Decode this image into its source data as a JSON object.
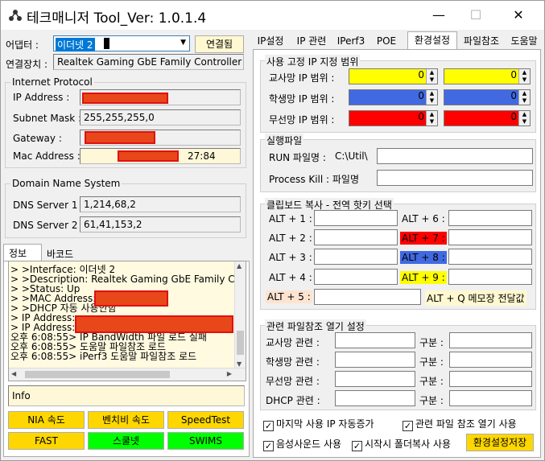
{
  "window": {
    "title_app": "테크매니저",
    "title_version": "Tool_Ver: 1.0.1.4",
    "minimize": "—",
    "maximize": "☐",
    "close": "✕"
  },
  "left": {
    "adapter_label": "어댑터 :",
    "adapter_value": "이더넷 2",
    "connect_button": "연결됨",
    "device_label": "연결장치 :",
    "device_value": "Realtek Gaming GbE Family Controller",
    "ip_group": "Internet Protocol",
    "ip_label": "IP Address :",
    "subnet_label": "Subnet Mask :",
    "subnet_value": "255,255,255,0",
    "gateway_label": "Gateway :",
    "mac_label": "Mac Address :",
    "mac_suffix": "27:84",
    "dns_group": "Domain Name System",
    "dns1_label": "DNS Server 1 :",
    "dns1_value": "1,214,68,2",
    "dns2_label": "DNS Server 2 :",
    "dns2_value": "61,41,153,2",
    "tab_info": "정보",
    "tab_barcode": "바코드",
    "log": [
      "> >Interface: 이더넷 2",
      "> >Description: Realtek Gaming GbE Family Cont",
      "> >Status: Up",
      "> >MAC Address:",
      "> >DHCP 자동 사용안함",
      "> IP Address:",
      "> IP Address:",
      "오후 6:08:55> IP BandWidth 파일 로드 실패",
      "오후 6:08:55> 도움말 파일참조 로드",
      "오후 6:08:55> iPerf3 도움말 파일참조 로드"
    ],
    "info_text": "Info",
    "buttons": {
      "nia": "NIA 속도",
      "bench": "벤치비 속도",
      "speedtest": "SpeedTest",
      "fast": "FAST",
      "school": "스쿨넷",
      "swims": "SWIMS"
    }
  },
  "right": {
    "tabs": [
      "IP설정",
      "IP 관련",
      "IPerf3",
      "POE",
      "환경설정",
      "파일참조",
      "도움말"
    ],
    "fixed_ip_group": "사용 고정 IP 지정 범위",
    "teacher_range": "교사망 IP 범위 :",
    "student_range": "학생망 IP 범위 :",
    "wireless_range": "무선망 IP 범위 :",
    "spin_value": "0",
    "run_group": "실행파일",
    "run_label": "RUN 파일명 :",
    "run_value": "C:\\Util\\",
    "kill_label": "Process Kill : 파일명",
    "clip_group": "클립보드 복사 - 전역 핫키 선택",
    "alt_labels": [
      "ALT + 1 :",
      "ALT + 2 :",
      "ALT + 3 :",
      "ALT + 4 :",
      "ALT + 5 :",
      "ALT + 6 :",
      "ALT + 7 :",
      "ALT + 8 :",
      "ALT + 9 :"
    ],
    "alt_q": "ALT + Q 메모장 전달값",
    "ref_group": "관련 파일참조 열기 설정",
    "ref_teacher": "교사망  관련 :",
    "ref_student": "학생망  관련 :",
    "ref_wireless": "무선망  관련 :",
    "ref_dhcp": "DHCP 관련 :",
    "gubun": "구분 :",
    "chk_auto_ip": "마지막 사용 IP 자동증가",
    "chk_open_ref": "관련 파일 참조 열기 사용",
    "chk_sound": "음성사운드 사용",
    "chk_startup": "시작시 폴더복사 사용",
    "save_button": "환경설정저장"
  },
  "colors": {
    "yellow": "#ffff00",
    "blue": "#4169e1",
    "red": "#ff0000",
    "green": "#00ff00",
    "button_yellow": "#ffd700",
    "redact": "#e8471a"
  }
}
